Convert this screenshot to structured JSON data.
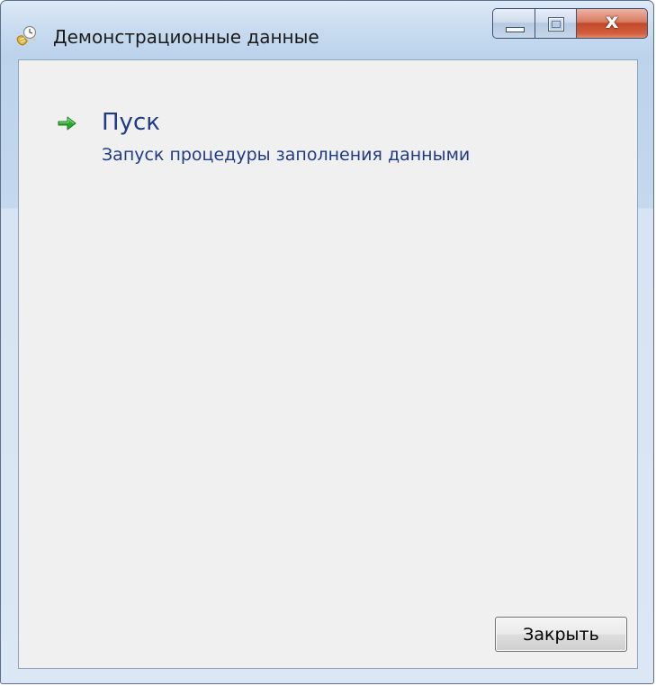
{
  "window": {
    "title": "Демонстрационные данные",
    "icon": "wizard-icon"
  },
  "caption_buttons": {
    "minimize": "minimize-icon",
    "maximize": "maximize-icon",
    "close_glyph": "x"
  },
  "task": {
    "icon": "green-arrow-icon",
    "icon_color": "#2fa82f",
    "title": "Пуск",
    "description": "Запуск процедуры заполнения данными"
  },
  "footer": {
    "close_label": "Закрыть"
  },
  "colors": {
    "link_text": "#1f3b86",
    "client_background": "#f0f0f0",
    "close_button_red": "#c2492a"
  }
}
